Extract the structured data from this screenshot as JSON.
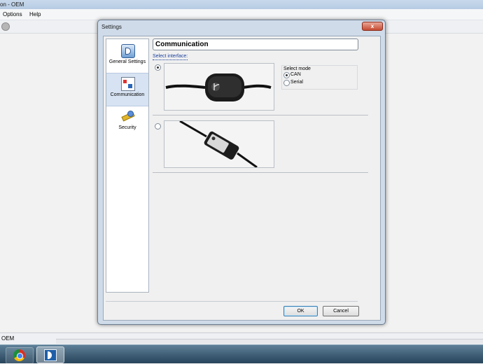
{
  "app": {
    "title": "on - OEM",
    "menu": [
      "Options",
      "Help"
    ],
    "status_text": "OEM"
  },
  "dialog": {
    "title": "Settings",
    "close_label": "x",
    "nav_items": [
      {
        "label": "General Settings",
        "icon": "general-settings-icon"
      },
      {
        "label": "Communication",
        "icon": "communication-icon",
        "selected": true
      },
      {
        "label": "Security",
        "icon": "security-icon"
      }
    ],
    "header": "Communication",
    "select_interface_label": "Select interface:",
    "interfaces": [
      {
        "name": "can-serial-interface",
        "selected": true
      },
      {
        "name": "usb-interface",
        "selected": false
      }
    ],
    "select_mode": {
      "title": "Select mode",
      "options": [
        {
          "label": "CAN",
          "selected": true
        },
        {
          "label": "Serial",
          "selected": false
        }
      ]
    },
    "buttons": {
      "ok": "OK",
      "cancel": "Cancel"
    }
  },
  "taskbar": {
    "items": [
      "chrome-icon",
      "app-icon"
    ]
  },
  "colors": {
    "accent": "#3c7fb1",
    "link_blue": "#1a3f9c",
    "close_red": "#c54b32"
  }
}
